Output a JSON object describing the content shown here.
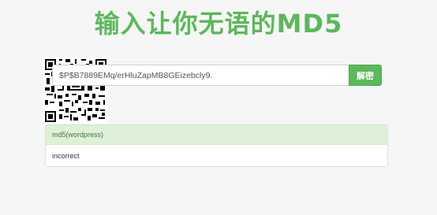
{
  "page": {
    "title": "输入让你无语的MD5"
  },
  "form": {
    "hash_value": "$P$B7889EMq/erHluZapMB8GEizebcly9.",
    "placeholder": "",
    "decrypt_label": "解密"
  },
  "result": {
    "type_label": "md5(wordpress)",
    "value": "incorrect"
  },
  "colors": {
    "accent": "#5cb85c",
    "panel_heading_bg": "#dff0d8",
    "panel_heading_text": "#3c763d"
  },
  "icons": {
    "qr": "qr-code-icon"
  }
}
